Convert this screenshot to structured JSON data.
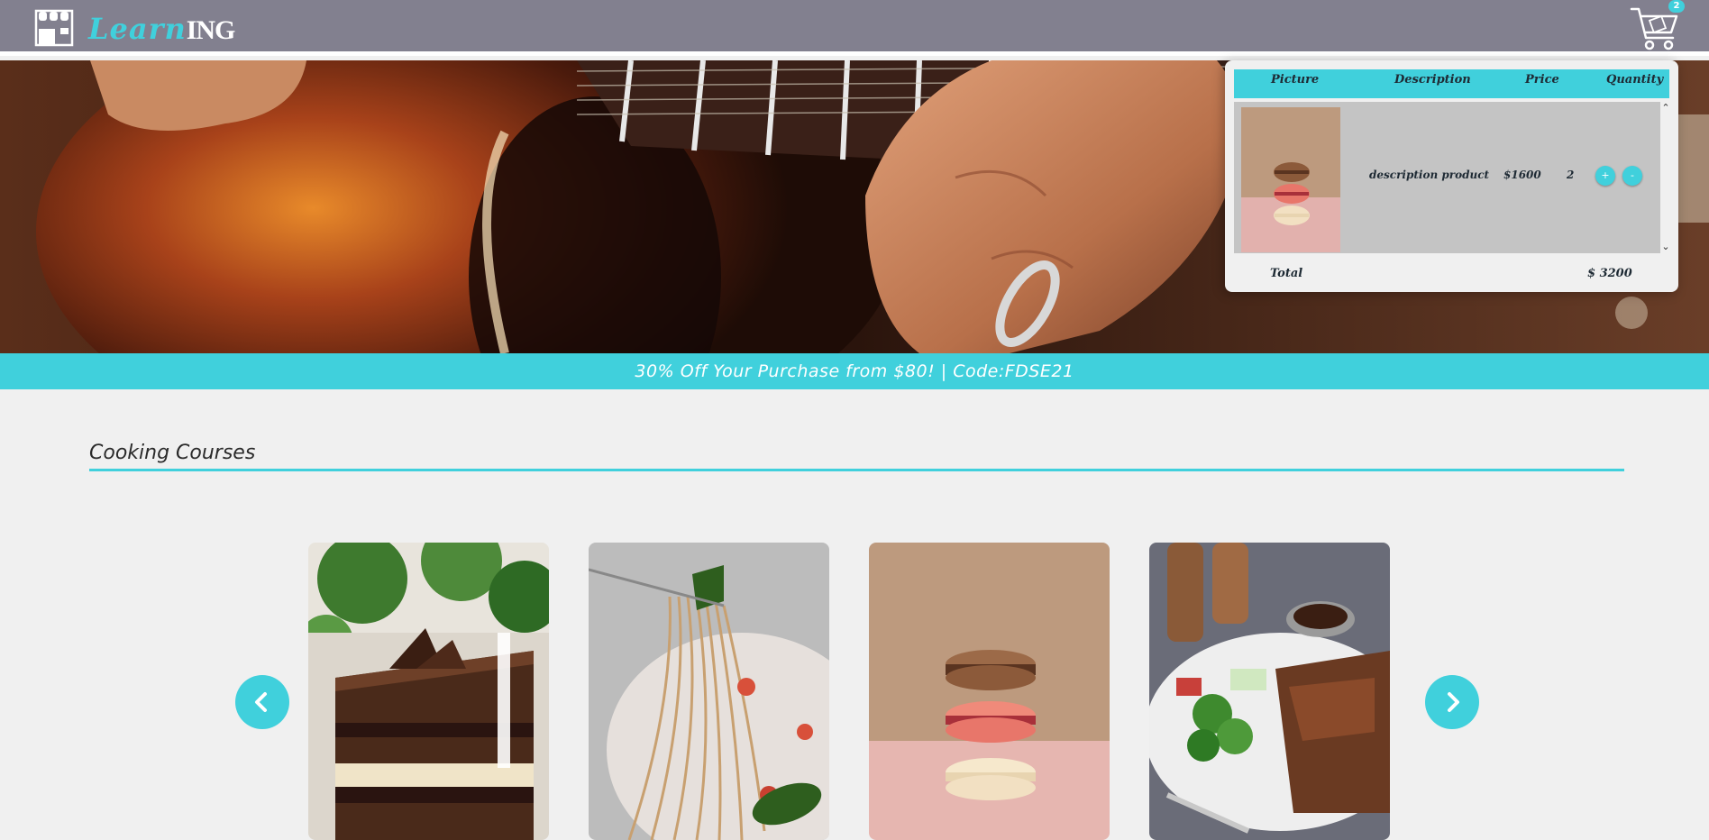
{
  "header": {
    "logo_icon": "store-icon",
    "logo_script": "Learn",
    "logo_caps": "ING",
    "cart_icon": "shopping-cart-icon",
    "cart_count": "2"
  },
  "hero": {
    "slide_count": 4,
    "active_slide": 1
  },
  "promo": {
    "text": "30% Off Your Purchase from $80! | Code:FDSE21"
  },
  "cart": {
    "columns": [
      "Picture",
      "Description",
      "Price",
      "Quantity"
    ],
    "items": [
      {
        "picture": "macarons-thumbnail",
        "description": "description product",
        "price": "$1600",
        "quantity": "2",
        "plus_label": "+",
        "minus_label": "-"
      }
    ],
    "total_label": "Total",
    "total_value": "$ 3200"
  },
  "section": {
    "title": "Cooking Courses"
  },
  "carousel": {
    "prev_icon": "chevron-left-icon",
    "next_icon": "chevron-right-icon",
    "cards": [
      "chocolate-cake",
      "spaghetti",
      "macarons",
      "steak-plate"
    ]
  },
  "colors": {
    "accent": "#40d0dc",
    "header_bg": "#82808f",
    "page_bg": "#f0f0f0",
    "cart_row_bg": "#c4c4c4"
  }
}
